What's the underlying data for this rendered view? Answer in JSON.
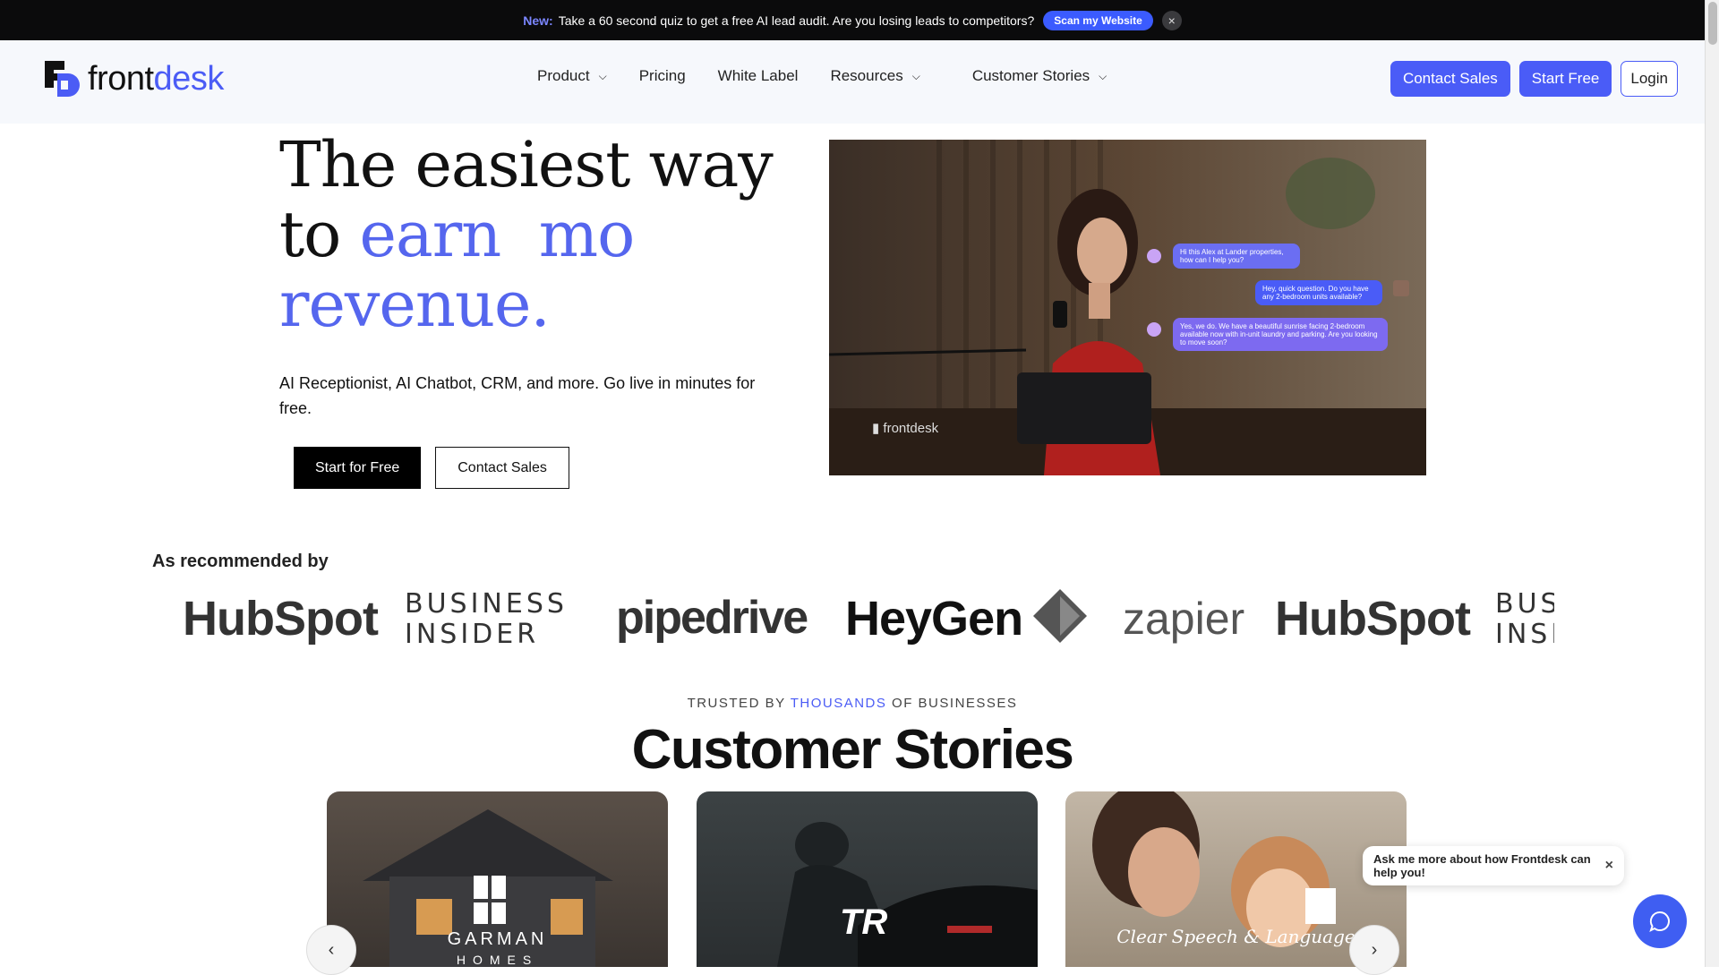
{
  "announcement": {
    "new_label": "New:",
    "text": "Take a 60 second quiz to get a free AI lead audit. Are you losing leads to competitors?",
    "cta": "Scan my Website",
    "close": "×"
  },
  "nav": {
    "logo_front": "front",
    "logo_desk": "desk",
    "menu": [
      {
        "label": "Product",
        "chevron": "⌄"
      },
      {
        "label": "Pricing"
      },
      {
        "label": "White Label"
      },
      {
        "label": "Resources",
        "chevron": "⌄"
      },
      {
        "label": "Customer Stories",
        "chevron": "⌄"
      }
    ],
    "contact_sales": "Contact Sales",
    "start_free": "Start Free",
    "login": "Login"
  },
  "hero": {
    "line1": "The easiest way",
    "line2_a": "to",
    "line2_b": "earn  more",
    "line3": "revenue.",
    "subtitle": "AI Receptionist, AI Chatbot, CRM, and more. Go live in minutes for free.",
    "primary_cta": "Start for Free",
    "secondary_cta": "Contact Sales"
  },
  "video": {
    "bubble1": "Hi this Alex at Lander properties, how can I help you?",
    "bubble2": "Hey, quick question. Do you have any 2-bedroom units available?",
    "bubble3": "Yes, we do. We have a beautiful sunrise facing 2-bedroom available now with in-unit laundry and parking. Are you looking to move soon?",
    "watermark": "frontdesk"
  },
  "recommended": {
    "title": "As recommended by",
    "logos": [
      "HubSpot",
      "BUSINESS INSIDER",
      "pipedrive",
      "HeyGen",
      "zapier",
      "HubSpot",
      "BUSINESS INSIDER"
    ]
  },
  "stories": {
    "trusted_pre": "TRUSTED BY ",
    "trusted_hl": "THOUSANDS",
    "trusted_post": " OF BUSINESSES",
    "title": "Customer Stories",
    "cards": [
      {
        "brand": "GARMAN",
        "sub": "HOMES"
      },
      {
        "brand": "TR",
        "sub": ""
      },
      {
        "brand": "Clear Speech & Language",
        "sub": ""
      }
    ],
    "prev": "‹",
    "next": "›"
  },
  "chat": {
    "prompt": "Ask me more about how Frontdesk can help you!",
    "close": "×"
  },
  "colors": {
    "accent": "#4a5cf7",
    "banner_bg": "#0b0b0c",
    "nav_bg": "#f6f8fc"
  }
}
